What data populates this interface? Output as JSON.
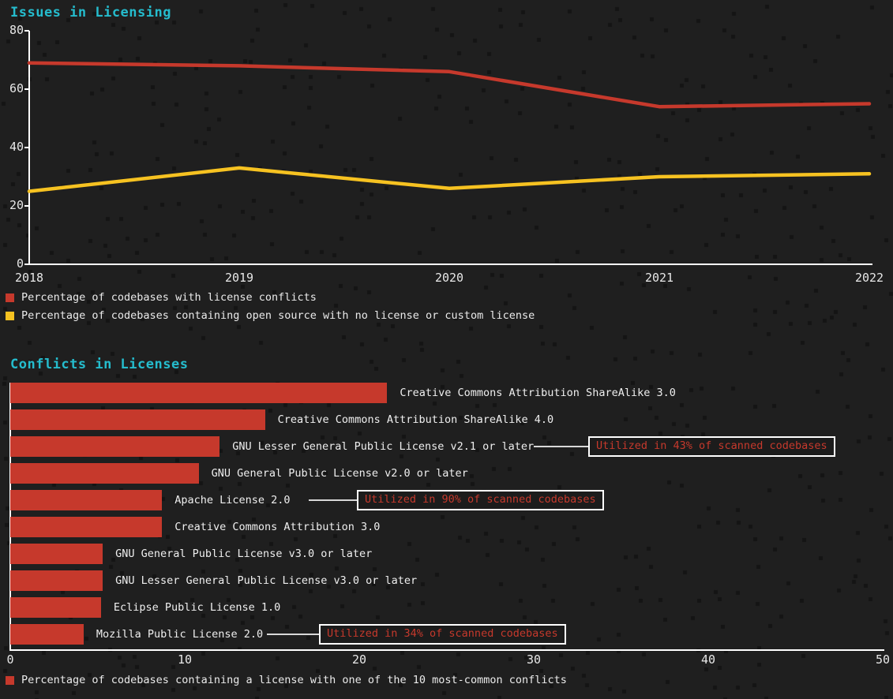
{
  "colors": {
    "background": "#1f1f1f",
    "dot": "#141414",
    "title": "#25bccd",
    "red": "#c6392c",
    "yellow": "#f6c221",
    "axis": "#ffffff",
    "text": "#ebebeb"
  },
  "line_section": {
    "title": "Issues in Licensing",
    "legend": [
      {
        "color": "#c6392c",
        "label": "Percentage of codebases with license conflicts"
      },
      {
        "color": "#f6c221",
        "label": "Percentage of codebases containing open source with no license or custom license"
      }
    ]
  },
  "bar_section": {
    "title": "Conflicts in Licenses",
    "legend": [
      {
        "color": "#c6392c",
        "label": "Percentage of codebases containing a license with one of the 10 most-common conflicts"
      }
    ],
    "annotations": [
      {
        "id": "anno-gnu-lgpl-v21",
        "text": "Utilized in 43% of scanned codebases",
        "bar_index": 2
      },
      {
        "id": "anno-apache-20",
        "text": "Utilized in 90% of scanned codebases",
        "bar_index": 4
      },
      {
        "id": "anno-mozilla-20",
        "text": "Utilized in 34% of scanned codebases",
        "bar_index": 9
      }
    ]
  },
  "chart_data": [
    {
      "type": "line",
      "title": "Issues in Licensing",
      "xlabel": "",
      "ylabel": "",
      "categories": [
        "2018",
        "2019",
        "2020",
        "2021",
        "2022"
      ],
      "x": [
        2018,
        2019,
        2020,
        2021,
        2022
      ],
      "ylim": [
        0,
        80
      ],
      "yticks": [
        0,
        20,
        40,
        60,
        80
      ],
      "grid": false,
      "legend_position": "below",
      "series": [
        {
          "name": "Percentage of codebases with license conflicts",
          "color": "#c6392c",
          "values": [
            69,
            68,
            66,
            54,
            55
          ]
        },
        {
          "name": "Percentage of codebases containing open source with no license or custom license",
          "color": "#f6c221",
          "values": [
            25,
            33,
            26,
            30,
            31
          ]
        }
      ]
    },
    {
      "type": "bar",
      "orientation": "horizontal",
      "title": "Conflicts in Licenses",
      "xlabel": "",
      "ylabel": "",
      "xlim": [
        0,
        50
      ],
      "xticks": [
        0,
        10,
        20,
        30,
        40,
        50
      ],
      "grid": false,
      "legend_position": "below",
      "series_name": "Percentage of codebases containing a license with one of the 10 most-common conflicts",
      "color": "#c6392c",
      "categories": [
        "Creative Commons Attribution ShareAlike 3.0",
        "Creative Commons Attribution ShareAlike 4.0",
        "GNU Lesser General Public License v2.1 or later",
        "GNU General Public License v2.0 or later",
        "Apache License 2.0",
        "Creative Commons Attribution 3.0",
        "GNU General Public License v3.0 or later",
        "GNU Lesser General Public License v3.0 or later",
        "Eclipse Public License 1.0",
        "Mozilla Public License 2.0"
      ],
      "values": [
        21.6,
        14.6,
        12.0,
        10.8,
        8.7,
        8.7,
        5.3,
        5.3,
        5.2,
        4.2
      ]
    }
  ],
  "line_geometry": {
    "plot_left": 37,
    "plot_right": 1101,
    "plot_top": 14,
    "plot_bottom": 310,
    "y_ticks": [
      {
        "label": "80",
        "value": 80
      },
      {
        "label": "60",
        "value": 60
      },
      {
        "label": "40",
        "value": 40
      },
      {
        "label": "20",
        "value": 20
      },
      {
        "label": "0",
        "value": 0
      }
    ],
    "x_ticks": [
      "2018",
      "2019",
      "2020",
      "2021",
      "2022"
    ]
  }
}
